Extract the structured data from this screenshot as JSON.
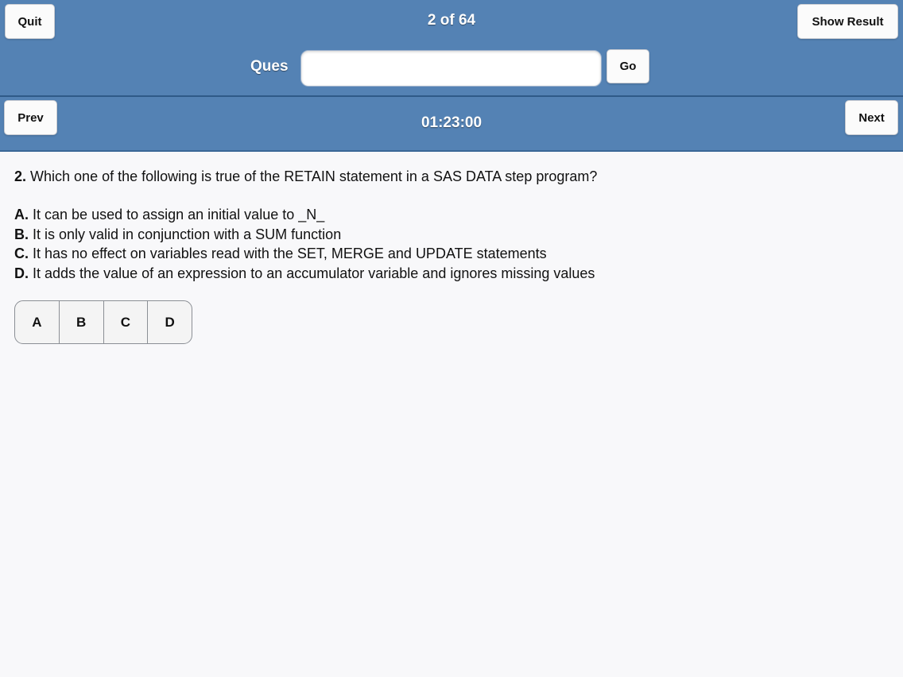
{
  "header": {
    "quit_label": "Quit",
    "progress": "2 of 64",
    "show_result_label": "Show Result",
    "ques_label": "Ques",
    "ques_input_value": "",
    "go_label": "Go",
    "prev_label": "Prev",
    "timer": "01:23:00",
    "next_label": "Next"
  },
  "question": {
    "number": "2.",
    "text": "Which one of the following is true of the RETAIN statement in a SAS DATA step program?",
    "options": [
      {
        "letter": "A.",
        "text": "It can be used to assign an initial value to _N_"
      },
      {
        "letter": "B.",
        "text": "It is only valid in conjunction with a SUM function"
      },
      {
        "letter": "C.",
        "text": "It has no effect on variables read with the SET, MERGE and UPDATE statements"
      },
      {
        "letter": "D.",
        "text": "It adds the value of an expression to an accumulator variable and ignores missing values"
      }
    ]
  },
  "answers": [
    "A",
    "B",
    "C",
    "D"
  ],
  "colors": {
    "header_bg": "#5482b4",
    "page_bg": "#f8f8fa"
  }
}
